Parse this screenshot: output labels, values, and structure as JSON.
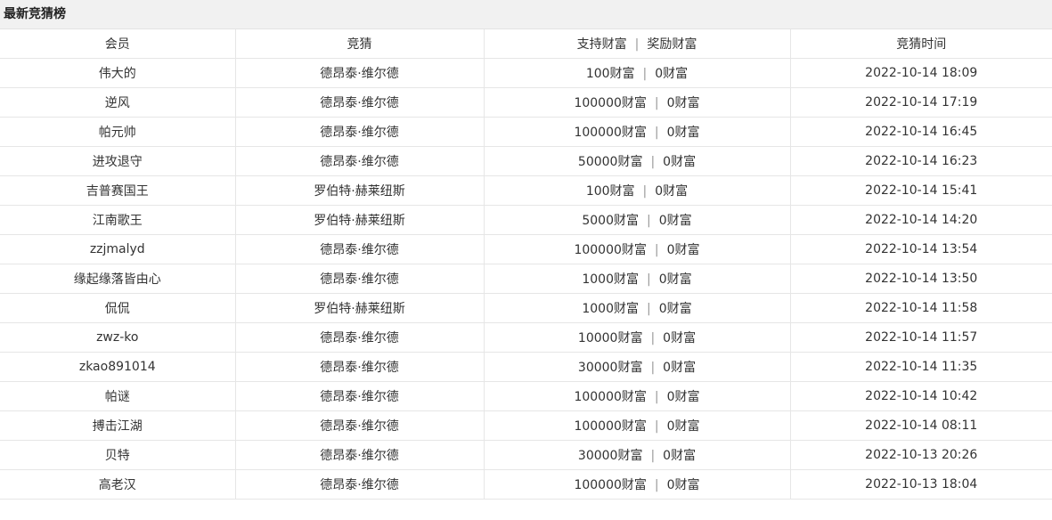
{
  "panel": {
    "title": "最新竞猜榜"
  },
  "table": {
    "headers": {
      "member": "会员",
      "guess": "竞猜",
      "support": "支持财富",
      "separator": "|",
      "reward": "奖励财富",
      "time": "竞猜时间"
    },
    "rows": [
      {
        "member": "伟大的",
        "guess": "德昂泰·维尔德",
        "support": "100财富",
        "reward": "0财富",
        "time": "2022-10-14 18:09"
      },
      {
        "member": "逆风",
        "guess": "德昂泰·维尔德",
        "support": "100000财富",
        "reward": "0财富",
        "time": "2022-10-14 17:19"
      },
      {
        "member": "帕元帅",
        "guess": "德昂泰·维尔德",
        "support": "100000财富",
        "reward": "0财富",
        "time": "2022-10-14 16:45"
      },
      {
        "member": "进攻退守",
        "guess": "德昂泰·维尔德",
        "support": "50000财富",
        "reward": "0财富",
        "time": "2022-10-14 16:23"
      },
      {
        "member": "吉普赛国王",
        "guess": "罗伯特·赫莱纽斯",
        "support": "100财富",
        "reward": "0财富",
        "time": "2022-10-14 15:41"
      },
      {
        "member": "江南歌王",
        "guess": "罗伯特·赫莱纽斯",
        "support": "5000财富",
        "reward": "0财富",
        "time": "2022-10-14 14:20"
      },
      {
        "member": "zzjmalyd",
        "guess": "德昂泰·维尔德",
        "support": "100000财富",
        "reward": "0财富",
        "time": "2022-10-14 13:54"
      },
      {
        "member": "缘起缘落皆由心",
        "guess": "德昂泰·维尔德",
        "support": "1000财富",
        "reward": "0财富",
        "time": "2022-10-14 13:50"
      },
      {
        "member": "侃侃",
        "guess": "罗伯特·赫莱纽斯",
        "support": "1000财富",
        "reward": "0财富",
        "time": "2022-10-14 11:58"
      },
      {
        "member": "zwz-ko",
        "guess": "德昂泰·维尔德",
        "support": "10000财富",
        "reward": "0财富",
        "time": "2022-10-14 11:57"
      },
      {
        "member": "zkao891014",
        "guess": "德昂泰·维尔德",
        "support": "30000财富",
        "reward": "0财富",
        "time": "2022-10-14 11:35"
      },
      {
        "member": "帕谜",
        "guess": "德昂泰·维尔德",
        "support": "100000财富",
        "reward": "0财富",
        "time": "2022-10-14 10:42"
      },
      {
        "member": "搏击江湖",
        "guess": "德昂泰·维尔德",
        "support": "100000财富",
        "reward": "0财富",
        "time": "2022-10-14 08:11"
      },
      {
        "member": "贝特",
        "guess": "德昂泰·维尔德",
        "support": "30000财富",
        "reward": "0财富",
        "time": "2022-10-13 20:26"
      },
      {
        "member": "高老汉",
        "guess": "德昂泰·维尔德",
        "support": "100000财富",
        "reward": "0财富",
        "time": "2022-10-13 18:04"
      }
    ]
  }
}
